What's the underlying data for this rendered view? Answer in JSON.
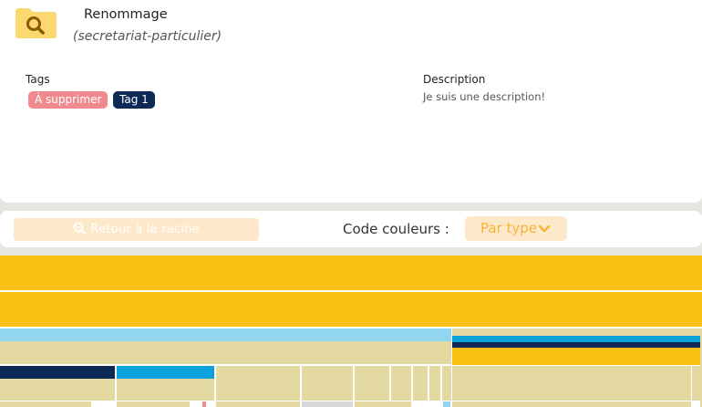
{
  "header": {
    "title": "Renommage",
    "subtitle": "(secretariat-particulier)",
    "icon": "folder-search-icon",
    "icon_color": "#fbd870"
  },
  "tags": {
    "label": "Tags",
    "items": [
      {
        "label": "À supprimer",
        "color": "#f08a8e"
      },
      {
        "label": "Tag 1",
        "color": "#0d2a57"
      }
    ]
  },
  "description": {
    "label": "Description",
    "value": "Je suis une description!"
  },
  "toolbar": {
    "root_button": "Retour à la racine",
    "root_icon": "zoom-out-icon",
    "color_code_label": "Code couleurs :",
    "color_mode": "Par type",
    "color_mode_icon": "chevron-down-icon"
  },
  "colors": {
    "accent": "#f9b233",
    "folder_yellow": "#f9bf12",
    "beige": "#e4d9a0",
    "light_blue": "#92d5ef",
    "mid_blue": "#0ba2db",
    "navy": "#0d2a57"
  }
}
